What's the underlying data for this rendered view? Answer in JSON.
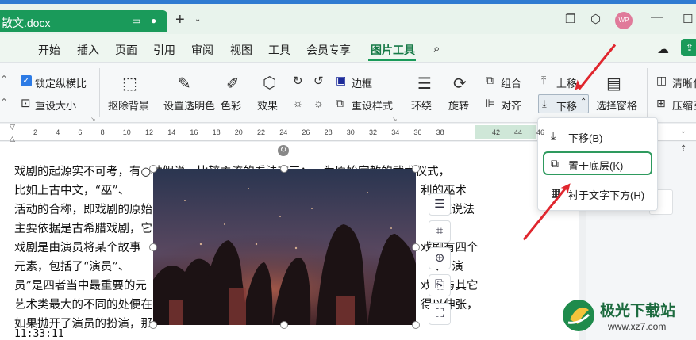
{
  "document": {
    "title": "散文.docx"
  },
  "avatar": {
    "text": "WP"
  },
  "menu": {
    "items": [
      "开始",
      "插入",
      "页面",
      "引用",
      "审阅",
      "视图",
      "工具",
      "会员专享",
      "图片工具"
    ],
    "active": "图片工具"
  },
  "toolbar": {
    "lock_ratio": "锁定纵横比",
    "reset_size": "重设大小",
    "remove_bg": "抠除背景",
    "set_transparent": "设置透明色",
    "color": "色彩",
    "effects": "效果",
    "border": "边框",
    "reset_style": "重设样式",
    "wrap": "环绕",
    "rotate": "旋转",
    "group": "组合",
    "align": "对齐",
    "move_up": "上移",
    "move_down": "下移",
    "selection_pane": "选择窗格",
    "sharpen": "清晰化",
    "compress": "压缩图"
  },
  "ruler": {
    "numbers": [
      "2",
      "4",
      "6",
      "8",
      "10",
      "12",
      "14",
      "16",
      "18",
      "20",
      "22",
      "24",
      "26",
      "28",
      "30",
      "32",
      "34",
      "36",
      "38",
      "42",
      "44",
      "46"
    ]
  },
  "body_lines": [
    "戏剧的起源实不可考，有○种假说，比较主流的看法有三：一为原始宗教的武术仪式，",
    "比如上古中文，“巫”、",
    "活动的合称，即戏剧的原始",
    "主要依据是古希腊戏剧，它",
    "戏剧是由演员将某个故事",
    "元素，包括了“演员”、",
    "员”是四者当中最重要的元",
    "艺术类最大的不同的处便在",
    "如果抛开了演员的扮演，那",
    "11:33:11"
  ],
  "body_right_fragments": [
    "利的巫术",
    "，这说法",
    "戏剧有四个",
    "”、“演",
    "戏剧与其它",
    "得以伸张，"
  ],
  "dropdown": {
    "items": [
      {
        "label": "下移(B)",
        "icon": "move-down-icon"
      },
      {
        "label": "置于底层(K)",
        "icon": "send-to-back-icon"
      },
      {
        "label": "衬于文字下方(H)",
        "icon": "behind-text-icon"
      }
    ],
    "highlighted": "置于底层(K)"
  },
  "watermark": {
    "name": "极光下载站",
    "url": "www.xz7.com"
  },
  "colors": {
    "accent": "#1a9a5a",
    "arrow": "#e0262e",
    "highlight_border": "#2e9a5e"
  }
}
